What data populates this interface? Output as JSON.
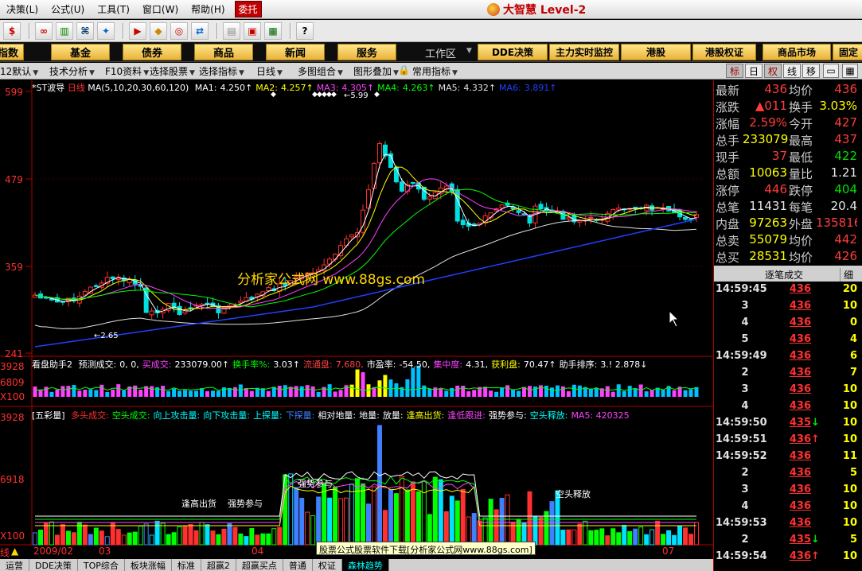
{
  "menu": {
    "items": [
      "决策(L)",
      "公式(U)",
      "工具(T)",
      "窗口(W)",
      "帮助(H)"
    ],
    "weituo": "委托",
    "brand": "大智慧 Level-2"
  },
  "toolbar": {
    "icons": [
      "dollar-icon",
      "glasses-icon",
      "bars-icon",
      "binoculars-icon",
      "flash-icon",
      "nav-icon",
      "diamond-icon",
      "refresh-icon",
      "swap-icon",
      "folder-icon",
      "window-icon",
      "books-icon",
      "help-pointer-icon"
    ]
  },
  "nav": {
    "buttons": [
      "指数",
      "基金",
      "债券",
      "商品",
      "新闻",
      "服务",
      "DDE决策",
      "主力实时监控",
      "港股",
      "港股权证",
      "商品市场",
      "固定"
    ],
    "workarea": "工作区"
  },
  "subbar": {
    "left": [
      "12默认",
      "技术分析",
      "F10资料",
      "选择股票",
      "选择指标",
      "日线",
      "多图组合",
      "图形叠加",
      "常用指标"
    ],
    "right": [
      "标",
      "日",
      "权",
      "线",
      "移"
    ]
  },
  "main_chart": {
    "stock": "*ST波导",
    "period": "日线",
    "ma_params": "MA(5,10,20,30,60,120)",
    "ma_values": [
      {
        "label": "MA1:",
        "value": "4.250",
        "color": "#ffffff"
      },
      {
        "label": "MA2:",
        "value": "4.257",
        "color": "#ffff00"
      },
      {
        "label": "MA3:",
        "value": "4.305",
        "color": "#ff40ff"
      },
      {
        "label": "MA4:",
        "value": "4.263",
        "color": "#00ff00"
      },
      {
        "label": "MA5:",
        "value": "4.332",
        "color": "#e0e0e0"
      },
      {
        "label": "MA6:",
        "value": "3.891",
        "color": "#2040ff"
      }
    ],
    "yticks": [
      "599",
      "479",
      "359",
      "241"
    ],
    "high_label": "5.99",
    "low_label": "2.65",
    "watermark": "分析家公式网 www.88gs.com"
  },
  "vol_panel": {
    "title": "看盘助手2",
    "fields": [
      {
        "label": "预测成交:",
        "value": "0, 0,",
        "color": "#ffffff"
      },
      {
        "label": "买成交:",
        "value": "233079.00↑",
        "color": "#ff40ff"
      },
      {
        "label": "换手率%:",
        "value": "3.03↑",
        "color": "#00ff00"
      },
      {
        "label": "流通盘:",
        "value": "7,680,",
        "color": "#ff4040"
      },
      {
        "label": "市盈率:",
        "value": "-54.50,",
        "color": "#ffffff"
      },
      {
        "label": "集中度:",
        "value": "4.31,",
        "color": "#ff40ff"
      },
      {
        "label": "获利盘:",
        "value": "70.47↑",
        "color": "#ffff00"
      },
      {
        "label": "助手排序:",
        "value": "3.! 2.878↓",
        "color": "#ffffff"
      }
    ],
    "yticks": [
      "3928",
      "6809",
      "X100"
    ]
  },
  "wucai_panel": {
    "title": "[五彩量]",
    "legend": [
      {
        "text": "多头成交:",
        "color": "#ff3030"
      },
      {
        "text": "空头成交:",
        "color": "#00ff00"
      },
      {
        "text": "向上攻击量:",
        "color": "#00ffff"
      },
      {
        "text": "向下攻击量:",
        "color": "#00ffff"
      },
      {
        "text": "上探量:",
        "color": "#00ffff"
      },
      {
        "text": "下探量:",
        "color": "#4080ff"
      },
      {
        "text": "相对地量:",
        "color": "#ffffff"
      },
      {
        "text": "地量:",
        "color": "#ffffff"
      },
      {
        "text": "放量:",
        "color": "#ffffff"
      },
      {
        "text": "逢高出货:",
        "color": "#ffff00"
      },
      {
        "text": "逢低跟进:",
        "color": "#ff40ff"
      },
      {
        "text": "强势参与:",
        "color": "#ffffff"
      },
      {
        "text": "空头释放:",
        "color": "#00ffff"
      },
      {
        "text": "MA5: 420325",
        "color": "#ff40ff"
      }
    ],
    "yticks": [
      "3928",
      "6918",
      "X100"
    ],
    "annotations": [
      "逢高出货",
      "强势参与",
      "强势参与",
      "空头释放"
    ]
  },
  "xaxis": {
    "labels": [
      "2009/02",
      "03",
      "04",
      "07"
    ],
    "mode": "线"
  },
  "tooltip": "股票公式股票软件下载[分析家公式网www.88gs.com]",
  "bottom_tabs": [
    "运营",
    "DDE决策",
    "TOP综合",
    "板块涨幅",
    "标准",
    "超赢2",
    "超赢买点",
    "普通",
    "权证",
    "森林趋势"
  ],
  "quote": {
    "rows": [
      {
        "l1": "最新",
        "v1": "436",
        "c1": "red",
        "l2": "均价",
        "v2": "436",
        "c2": "red"
      },
      {
        "l1": "涨跌",
        "v1": "▲011",
        "c1": "red",
        "l2": "换手",
        "v2": "3.03%",
        "c2": "yellow"
      },
      {
        "l1": "涨幅",
        "v1": "2.59%",
        "c1": "red",
        "l2": "今开",
        "v2": "427",
        "c2": "red"
      },
      {
        "l1": "总手",
        "v1": "233079",
        "c1": "yellow",
        "l2": "最高",
        "v2": "437",
        "c2": "red"
      },
      {
        "l1": "现手",
        "v1": "37",
        "c1": "red",
        "l2": "最低",
        "v2": "422",
        "c2": "green"
      },
      {
        "l1": "总额",
        "v1": "10063",
        "c1": "yellow",
        "l2": "量比",
        "v2": "1.21",
        "c2": "white"
      },
      {
        "l1": "涨停",
        "v1": "446",
        "c1": "red",
        "l2": "跌停",
        "v2": "404",
        "c2": "green"
      },
      {
        "l1": "总笔",
        "v1": "11431",
        "c1": "white",
        "l2": "每笔",
        "v2": "20.4",
        "c2": "white"
      },
      {
        "l1": "内盘",
        "v1": "97263",
        "c1": "yellow",
        "l2": "外盘",
        "v2": "135816",
        "c2": "red"
      },
      {
        "l1": "总卖",
        "v1": "55079",
        "c1": "yellow",
        "l2": "均价",
        "v2": "442",
        "c2": "red"
      },
      {
        "l1": "总买",
        "v1": "28531",
        "c1": "yellow",
        "l2": "均价",
        "v2": "426",
        "c2": "red"
      }
    ]
  },
  "ticks": {
    "header": "逐笔成交",
    "header2": "细",
    "rows": [
      {
        "t": "14:59:45",
        "p": "436",
        "a": "",
        "q": "20"
      },
      {
        "t": "3",
        "p": "436",
        "a": "",
        "q": "10"
      },
      {
        "t": "4",
        "p": "436",
        "a": "",
        "q": "0"
      },
      {
        "t": "5",
        "p": "436",
        "a": "",
        "q": "4"
      },
      {
        "t": "14:59:49",
        "p": "436",
        "a": "",
        "q": "6"
      },
      {
        "t": "2",
        "p": "436",
        "a": "",
        "q": "7"
      },
      {
        "t": "3",
        "p": "436",
        "a": "",
        "q": "10"
      },
      {
        "t": "4",
        "p": "436",
        "a": "",
        "q": "10"
      },
      {
        "t": "14:59:50",
        "p": "435",
        "a": "↓",
        "q": "10"
      },
      {
        "t": "14:59:51",
        "p": "436",
        "a": "↑",
        "q": "10"
      },
      {
        "t": "14:59:52",
        "p": "436",
        "a": "",
        "q": "11"
      },
      {
        "t": "2",
        "p": "436",
        "a": "",
        "q": "5"
      },
      {
        "t": "3",
        "p": "436",
        "a": "",
        "q": "10"
      },
      {
        "t": "4",
        "p": "436",
        "a": "",
        "q": "10"
      },
      {
        "t": "14:59:53",
        "p": "436",
        "a": "",
        "q": "10"
      },
      {
        "t": "2",
        "p": "435",
        "a": "↓",
        "q": "5"
      },
      {
        "t": "14:59:54",
        "p": "436",
        "a": "↑",
        "q": "10"
      }
    ]
  }
}
